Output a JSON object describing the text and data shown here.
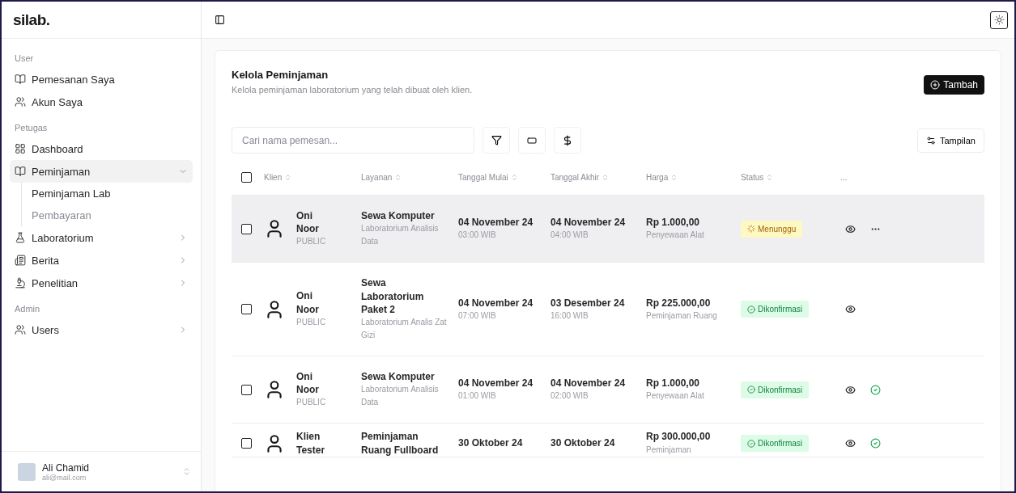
{
  "sidebar": {
    "logo": "silab.",
    "sections": [
      {
        "title": "User",
        "items": [
          {
            "label": "Pemesanan Saya",
            "selected": false
          },
          {
            "label": "Akun Saya",
            "selected": false
          }
        ]
      },
      {
        "title": "Petugas",
        "items": [
          {
            "label": "Dashboard",
            "selected": false
          },
          {
            "label": "Peminjaman",
            "selected": true,
            "expanded": true,
            "children": [
              {
                "label": "Peminjaman Lab",
                "selected": true
              },
              {
                "label": "Pembayaran",
                "selected": false
              }
            ]
          },
          {
            "label": "Laboratorium",
            "selected": false,
            "expanded": false
          },
          {
            "label": "Berita",
            "selected": false,
            "expanded": false
          },
          {
            "label": "Penelitian",
            "selected": false,
            "expanded": false
          }
        ]
      },
      {
        "title": "Admin",
        "items": [
          {
            "label": "Users",
            "selected": false,
            "expanded": false
          }
        ]
      }
    ],
    "user": {
      "name": "Ali Chamid",
      "email": "ali@mail.com"
    }
  },
  "page": {
    "title": "Kelola Peminjaman",
    "subtitle": "Kelola peminjaman laboratorium yang telah dibuat oleh klien.",
    "add_button": "Tambah",
    "search": {
      "placeholder": "Cari nama pemesan..."
    },
    "view_button": "Tampilan"
  },
  "table": {
    "all_checked": false,
    "columns": [
      "Klien",
      "Layanan",
      "Tanggal Mulai",
      "Tanggal Akhir",
      "Harga",
      "Status"
    ],
    "actions_header": "...",
    "rows": [
      {
        "checked": false,
        "hovered": true,
        "client": [
          "Oni",
          "Noor"
        ],
        "role": "PUBLIC",
        "service": "Sewa Komputer",
        "service_detail": "Laboratorium Analisis Data",
        "start": "04 November 24",
        "start_time": "03:00 WIB",
        "end": "04 November 24",
        "end_time": "04:00 WIB",
        "price": "Rp 1.000,00",
        "price_detail": "Penyewaan Alat",
        "status": {
          "kind": "pending",
          "label": "Menunggu"
        },
        "actions": [
          {
            "kind": "view"
          },
          {
            "kind": "more"
          }
        ]
      },
      {
        "checked": false,
        "hovered": false,
        "client": [
          "Oni",
          "Noor"
        ],
        "role": "PUBLIC",
        "service": "Sewa Laboratorium Paket 2",
        "service_detail": "Laboratorium Analis Zat Gizi",
        "start": "04 November 24",
        "start_time": "07:00 WIB",
        "end": "03 Desember 24",
        "end_time": "16:00 WIB",
        "price": "Rp 225.000,00",
        "price_detail": "Peminjaman Ruang",
        "status": {
          "kind": "confirmed",
          "label": "Dikonfirmasi"
        },
        "actions": [
          {
            "kind": "view"
          }
        ]
      },
      {
        "checked": false,
        "hovered": false,
        "client": [
          "Oni",
          "Noor"
        ],
        "role": "PUBLIC",
        "service": "Sewa Komputer",
        "service_detail": "Laboratorium Analisis Data",
        "start": "04 November 24",
        "start_time": "01:00 WIB",
        "end": "04 November 24",
        "end_time": "02:00 WIB",
        "price": "Rp 1.000,00",
        "price_detail": "Penyewaan Alat",
        "status": {
          "kind": "confirmed",
          "label": "Dikonfirmasi"
        },
        "actions": [
          {
            "kind": "view"
          },
          {
            "kind": "confirm"
          }
        ]
      },
      {
        "checked": false,
        "hovered": false,
        "client": [
          "Klien",
          "Tester"
        ],
        "service": "Peminjaman Ruang Fullboard",
        "start": "30 Oktober 24",
        "end": "30 Oktober 24",
        "price": "Rp 300.000,00",
        "price_detail": "Peminjaman",
        "status": {
          "kind": "confirmed",
          "label": "Dikonfirmasi"
        },
        "actions": [
          {
            "kind": "view"
          },
          {
            "kind": "confirm"
          }
        ]
      }
    ]
  }
}
